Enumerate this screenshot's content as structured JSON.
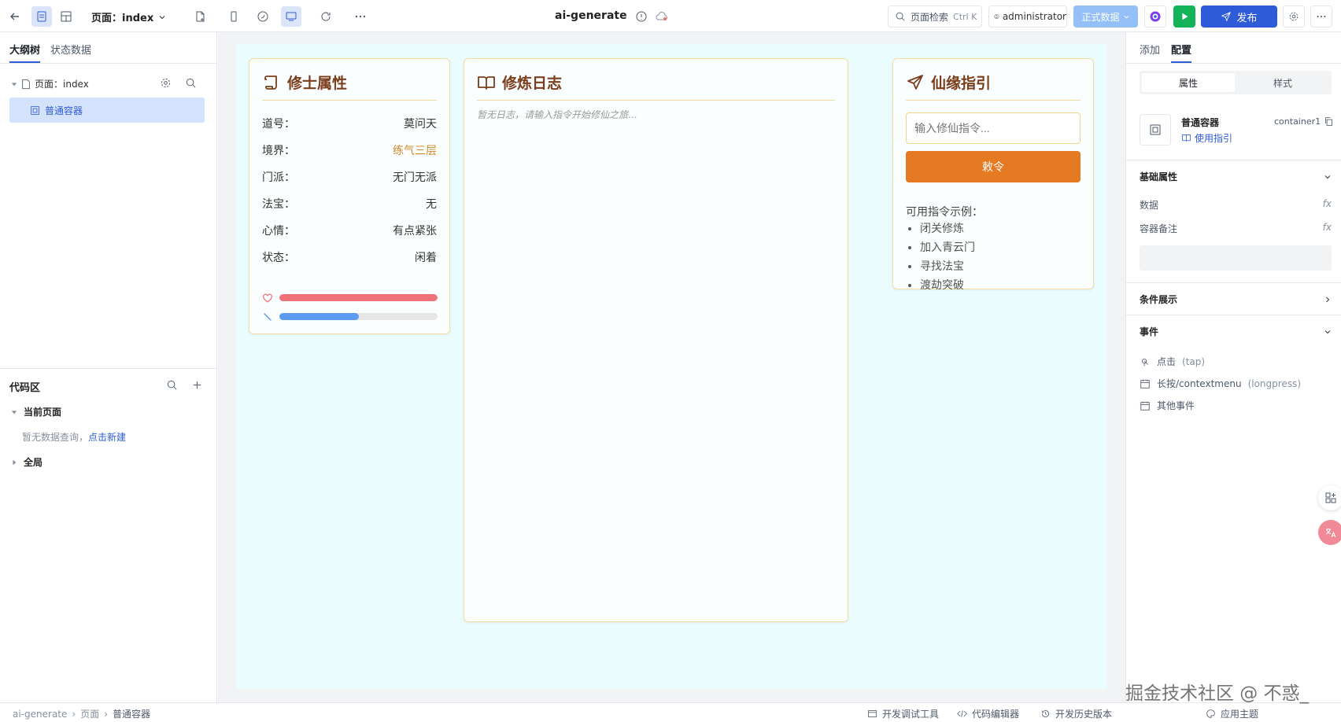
{
  "topbar": {
    "page_label": "页面：index",
    "app_title": "ai-generate",
    "search_label": "页面检索",
    "search_shortcut": "Ctrl K",
    "user": "administrator",
    "env_label": "正式数据",
    "publish_label": "发布"
  },
  "left": {
    "tabs": [
      "大纲树",
      "状态数据"
    ],
    "tree_page": "页面：index",
    "tree_container": "普通容器",
    "code_title": "代码区",
    "current_page": "当前页面",
    "no_query": "暂无数据查询，",
    "new_link": "点击新建",
    "global": "全局"
  },
  "cards": {
    "attrs": {
      "title": "修士属性",
      "rows": [
        {
          "label": "道号：",
          "value": "莫问天"
        },
        {
          "label": "境界：",
          "value": "练气三层"
        },
        {
          "label": "门派：",
          "value": "无门无派"
        },
        {
          "label": "法宝：",
          "value": "无"
        },
        {
          "label": "心情：",
          "value": "有点紧张"
        },
        {
          "label": "状态：",
          "value": "闲着"
        }
      ],
      "hp_fraction": 1.0,
      "mana_fraction": 0.5
    },
    "log": {
      "title": "修炼日志",
      "empty": "暂无日志，请输入指令开始修仙之旅..."
    },
    "guide": {
      "title": "仙缘指引",
      "placeholder": "输入修仙指令...",
      "button": "敕令",
      "examples_title": "可用指令示例：",
      "examples": [
        "闭关修炼",
        "加入青云门",
        "寻找法宝",
        "渡劫突破"
      ]
    }
  },
  "right": {
    "tabs": [
      "添加",
      "配置"
    ],
    "seg": [
      "属性",
      "样式"
    ],
    "comp_name": "普通容器",
    "comp_id": "container1",
    "guide_link": "使用指引",
    "basic": "基础属性",
    "data_label": "数据",
    "note_label": "容器备注",
    "fx": "fx",
    "cond": "条件展示",
    "events": "事件",
    "event_items": [
      "点击",
      "(tap)",
      "长按/contextmenu",
      "(longpress)",
      "其他事件"
    ]
  },
  "status": {
    "crumbs": [
      "ai-generate",
      "页面",
      "普通容器"
    ],
    "debug": "开发调试工具",
    "editor": "代码编辑器",
    "history": "开发历史版本",
    "theme": "应用主题"
  },
  "watermark": "掘金技术社区 @ 不惑_",
  "colors": {
    "accent": "#2e5bd7",
    "card_border": "#f3dfa2",
    "realm": "#d08a2b",
    "cmd_button": "#e57a23",
    "hp": "#f07178",
    "mana": "#5b9bf0"
  }
}
